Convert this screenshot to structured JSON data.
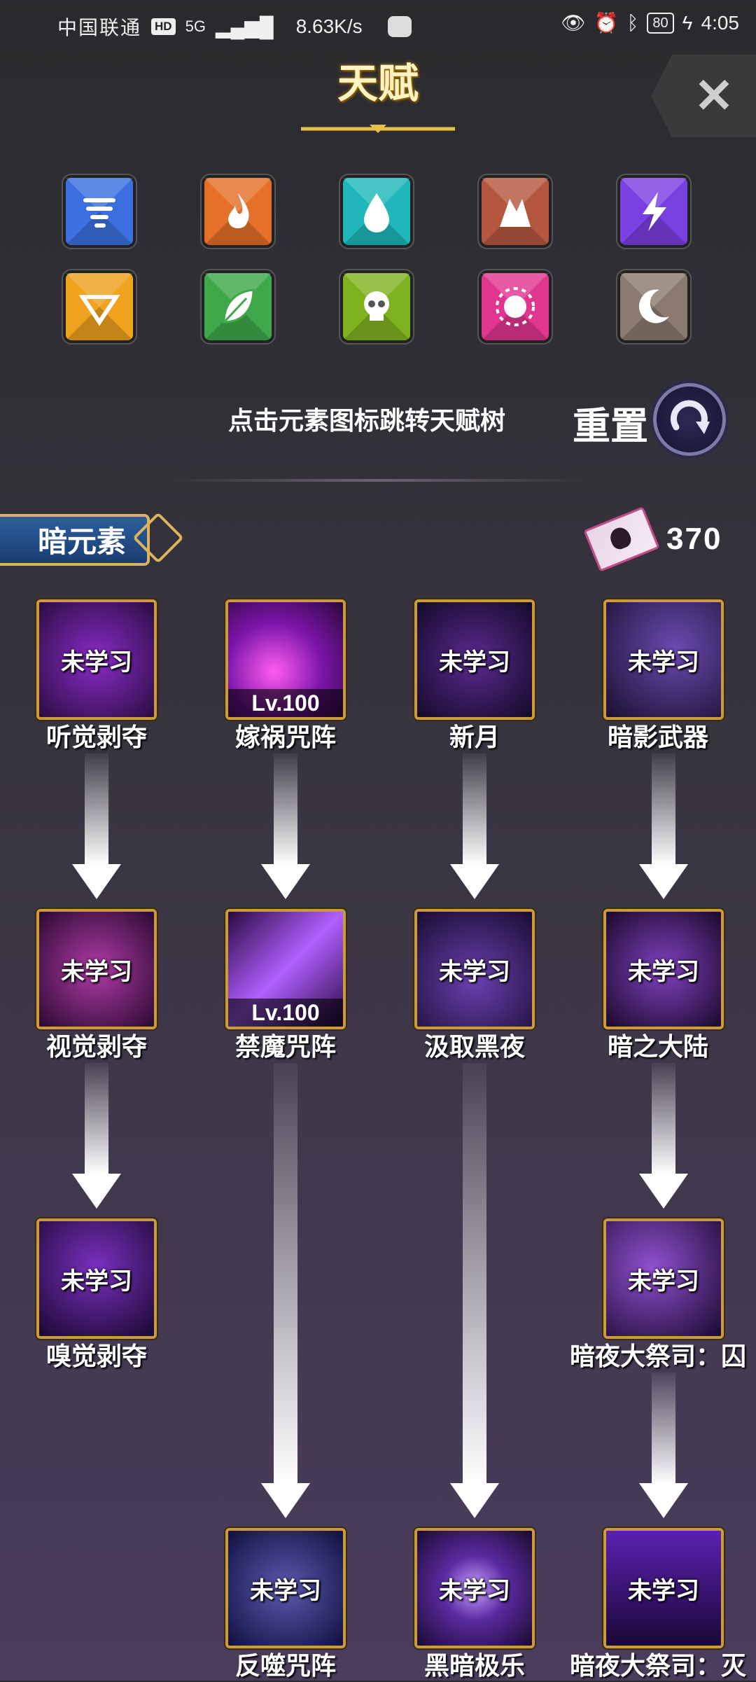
{
  "status_bar": {
    "carrier": "中国联通",
    "hd": "HD",
    "signal": "5G",
    "speed": "8.63K/s",
    "battery": "80",
    "time": "4:05"
  },
  "header": {
    "title": "天赋",
    "close_label": "✕"
  },
  "elements": [
    {
      "name": "wind",
      "icon": "tornado-icon",
      "color": "#3b6fe0"
    },
    {
      "name": "fire",
      "icon": "flame-icon",
      "color": "#e5702a"
    },
    {
      "name": "water",
      "icon": "drop-icon",
      "color": "#1fb7b9"
    },
    {
      "name": "earth",
      "icon": "rock-icon",
      "color": "#b5573e"
    },
    {
      "name": "thunder",
      "icon": "lightning-icon",
      "color": "#7a3fe0"
    },
    {
      "name": "light",
      "icon": "prism-icon",
      "color": "#f0a31e"
    },
    {
      "name": "nature",
      "icon": "leaf-icon",
      "color": "#3fa84a"
    },
    {
      "name": "poison",
      "icon": "skull-icon",
      "color": "#7fb21f"
    },
    {
      "name": "sun",
      "icon": "sun-icon",
      "color": "#e0368f"
    },
    {
      "name": "moon",
      "icon": "moon-icon",
      "color": "#8a7a70"
    }
  ],
  "hint": "点击元素图标跳转天赋树",
  "reset_label": "重置",
  "section": {
    "label": "暗元素",
    "points": "370"
  },
  "nodes": [
    {
      "label": "听觉剥夺",
      "status": "未学习",
      "level": ""
    },
    {
      "label": "嫁祸咒阵",
      "status": "",
      "level": "Lv.100"
    },
    {
      "label": "新月",
      "status": "未学习",
      "level": ""
    },
    {
      "label": "暗影武器",
      "status": "未学习",
      "level": ""
    },
    {
      "label": "视觉剥夺",
      "status": "未学习",
      "level": ""
    },
    {
      "label": "禁魔咒阵",
      "status": "",
      "level": "Lv.100"
    },
    {
      "label": "汲取黑夜",
      "status": "未学习",
      "level": ""
    },
    {
      "label": "暗之大陆",
      "status": "未学习",
      "level": ""
    },
    {
      "label": "嗅觉剥夺",
      "status": "未学习",
      "level": ""
    },
    {
      "label": "暗夜大祭司：囚",
      "status": "未学习",
      "level": ""
    },
    {
      "label": "反噬咒阵",
      "status": "未学习",
      "level": ""
    },
    {
      "label": "黑暗极乐",
      "status": "未学习",
      "level": ""
    },
    {
      "label": "暗夜大祭司：灭",
      "status": "未学习",
      "level": ""
    }
  ]
}
